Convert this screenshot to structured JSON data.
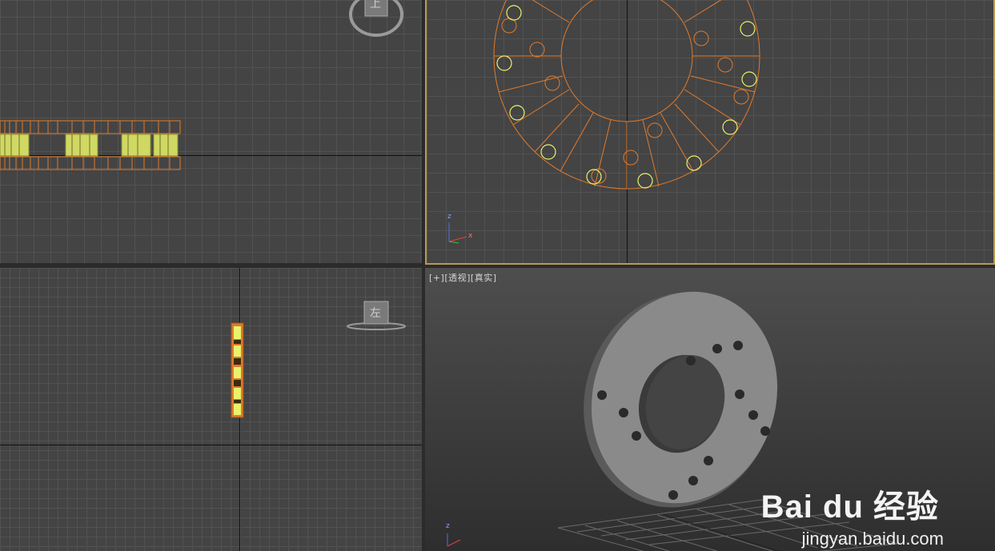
{
  "viewports": {
    "perspective": {
      "label_plus": "[+]",
      "label_view": "[透视]",
      "label_shading": "[真实]"
    },
    "top": {
      "viewcube_face": "上"
    },
    "left": {
      "viewcube_face": "左"
    }
  },
  "axis_tripod": {
    "z": "z",
    "x": "x"
  },
  "watermark": {
    "brand": "Bai du 经验",
    "url": "jingyan.baidu.com"
  },
  "colors": {
    "viewport_bg": "#444444",
    "grid_line": "#525252",
    "wire_orange": "#e07a2c",
    "selected_yellow": "#e9f26a",
    "active_border": "#b59a52"
  }
}
